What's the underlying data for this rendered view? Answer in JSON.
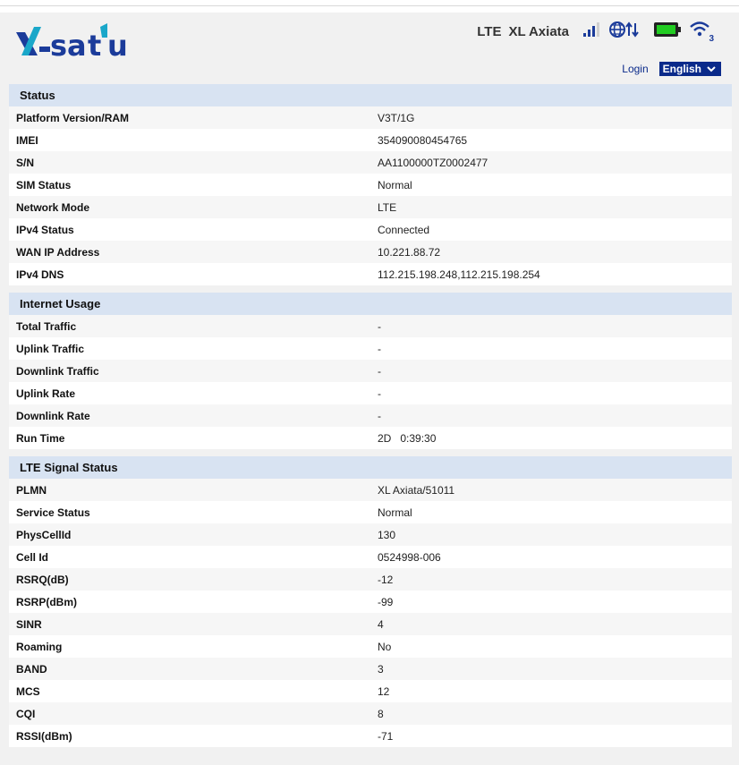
{
  "header": {
    "logo_text": "XL satu",
    "network_type": "LTE",
    "operator": "XL Axiata",
    "wifi_clients": "3",
    "signal_icon": "signal-bars-icon",
    "data_icon": "globe-data-icon",
    "battery_icon": "battery-icon",
    "wifi_icon": "wifi-icon",
    "brand_color": "#1b3b9a",
    "accent_color": "#1aa7c9"
  },
  "nav": {
    "login_label": "Login",
    "language_selected": "English"
  },
  "sections": [
    {
      "title": "Status",
      "rows": [
        {
          "label": "Platform Version/RAM",
          "value": "V3T/1G"
        },
        {
          "label": "IMEI",
          "value": "354090080454765"
        },
        {
          "label": "S/N",
          "value": "AA1100000TZ0002477"
        },
        {
          "label": "SIM Status",
          "value": "Normal"
        },
        {
          "label": "Network Mode",
          "value": "LTE"
        },
        {
          "label": "IPv4 Status",
          "value": "Connected"
        },
        {
          "label": "WAN IP Address",
          "value": "10.221.88.72"
        },
        {
          "label": "IPv4 DNS",
          "value": "112.215.198.248,112.215.198.254"
        }
      ]
    },
    {
      "title": "Internet Usage",
      "rows": [
        {
          "label": "Total Traffic",
          "value": "-"
        },
        {
          "label": "Uplink Traffic",
          "value": "-"
        },
        {
          "label": "Downlink Traffic",
          "value": "-"
        },
        {
          "label": "Uplink Rate",
          "value": "-"
        },
        {
          "label": "Downlink Rate",
          "value": "-"
        },
        {
          "label": "Run Time",
          "value": "2D   0:39:30"
        }
      ]
    },
    {
      "title": "LTE Signal Status",
      "rows": [
        {
          "label": "PLMN",
          "value": "XL Axiata/51011"
        },
        {
          "label": "Service Status",
          "value": "Normal"
        },
        {
          "label": "PhysCellId",
          "value": "130"
        },
        {
          "label": "Cell Id",
          "value": "0524998-006"
        },
        {
          "label": "RSRQ(dB)",
          "value": "-12"
        },
        {
          "label": "RSRP(dBm)",
          "value": "-99"
        },
        {
          "label": "SINR",
          "value": "4"
        },
        {
          "label": "Roaming",
          "value": "No"
        },
        {
          "label": "BAND",
          "value": "3"
        },
        {
          "label": "MCS",
          "value": "12"
        },
        {
          "label": "CQI",
          "value": "8"
        },
        {
          "label": "RSSI(dBm)",
          "value": "-71"
        }
      ]
    }
  ]
}
